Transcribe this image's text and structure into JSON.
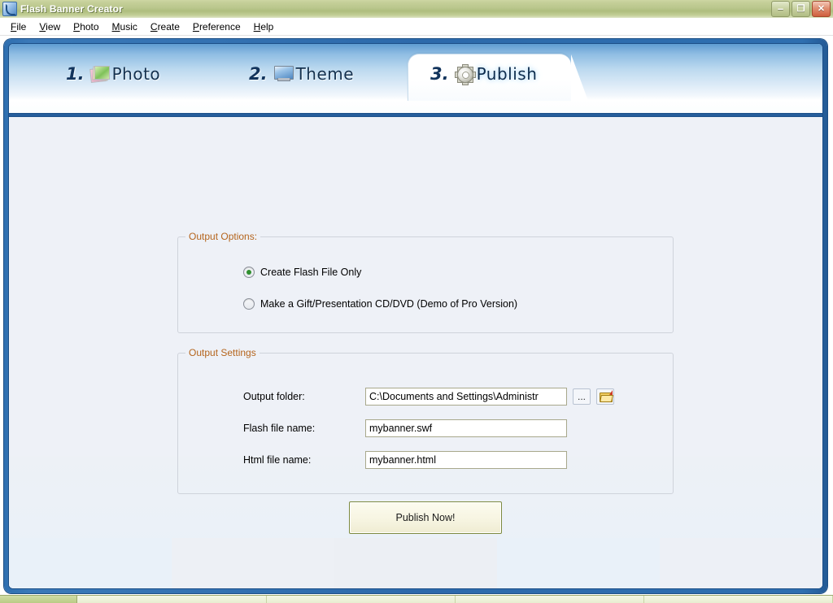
{
  "window": {
    "title": "Flash Banner Creator",
    "icon": "app-icon",
    "controls": {
      "minimize": "–",
      "restore": "❐",
      "close": "✕"
    }
  },
  "menubar": {
    "items": [
      {
        "accel": "F",
        "rest": "ile"
      },
      {
        "accel": "V",
        "rest": "iew"
      },
      {
        "accel": "P",
        "rest": "hoto"
      },
      {
        "accel": "M",
        "rest": "usic"
      },
      {
        "accel": "C",
        "rest": "reate"
      },
      {
        "accel": "P",
        "rest": "reference"
      },
      {
        "accel": "H",
        "rest": "elp"
      }
    ]
  },
  "tabs": [
    {
      "num": "1.",
      "label": "Photo",
      "icon": "photo-stack-icon",
      "active": false
    },
    {
      "num": "2.",
      "label": "Theme",
      "icon": "monitor-icon",
      "active": false
    },
    {
      "num": "3.",
      "label": "Publish",
      "icon": "gear-icon",
      "active": true
    }
  ],
  "output_options": {
    "group_title": "Output Options:",
    "choices": [
      {
        "label": "Create Flash File Only",
        "selected": true
      },
      {
        "label": "Make a Gift/Presentation CD/DVD (Demo of Pro Version)",
        "selected": false
      }
    ]
  },
  "output_settings": {
    "group_title": "Output Settings",
    "fields": [
      {
        "label": "Output folder:",
        "value": "C:\\Documents and Settings\\Administr",
        "placeholder": ""
      },
      {
        "label": "Flash file name:",
        "value": "mybanner.swf",
        "placeholder": ""
      },
      {
        "label": "Html file name:",
        "value": "mybanner.html",
        "placeholder": ""
      }
    ],
    "browse_button": "...",
    "open_folder_icon": "open-folder-icon"
  },
  "actions": {
    "publish": "Publish Now!"
  },
  "colors": {
    "titlebar_olive": "#b9c68c",
    "window_blue": "#2d6aab",
    "group_label_orange": "#b5651d",
    "radio_selected_green": "#2f8f2f",
    "publish_border_olive": "#7d8a3f",
    "content_bg": "#eef1f7"
  }
}
